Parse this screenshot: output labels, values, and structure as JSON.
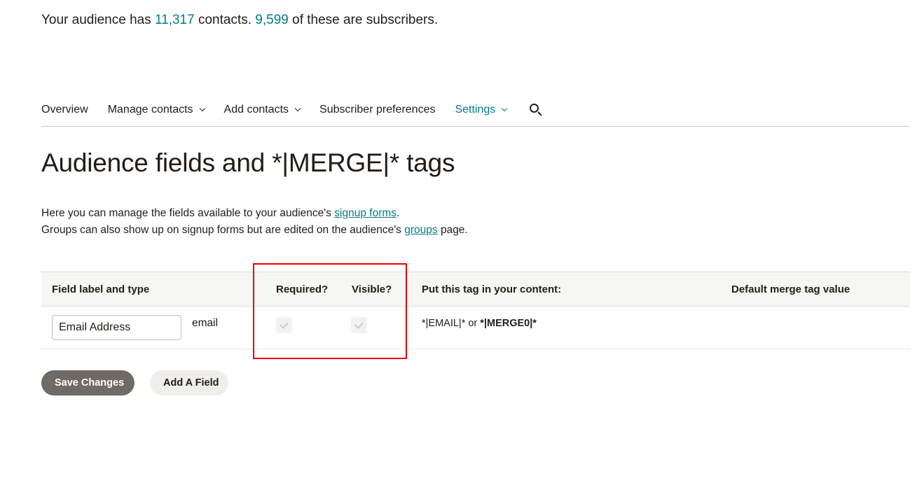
{
  "summary": {
    "prefix": "Your audience has ",
    "contacts_count": "11,317",
    "middle": " contacts. ",
    "subscribers_count": "9,599",
    "suffix": " of these are subscribers."
  },
  "nav": {
    "items": [
      {
        "label": "Overview",
        "has_dropdown": false,
        "active": false
      },
      {
        "label": "Manage contacts",
        "has_dropdown": true,
        "active": false
      },
      {
        "label": "Add contacts",
        "has_dropdown": true,
        "active": false
      },
      {
        "label": "Subscriber preferences",
        "has_dropdown": false,
        "active": false
      },
      {
        "label": "Settings",
        "has_dropdown": true,
        "active": true
      }
    ],
    "search_icon": "search-icon"
  },
  "page": {
    "title": "Audience fields and *|MERGE|* tags",
    "intro_line1_prefix": "Here you can manage the fields available to your audience's ",
    "intro_link1": "signup forms",
    "intro_line1_suffix": ".",
    "intro_line2_prefix": "Groups can also show up on signup forms but are edited on the audience's ",
    "intro_link2": "groups",
    "intro_line2_suffix": " page."
  },
  "table": {
    "headers": {
      "field": "Field label and type",
      "required": "Required?",
      "visible": "Visible?",
      "tag": "Put this tag in your content:",
      "default": "Default merge tag value"
    },
    "rows": [
      {
        "label_value": "Email Address",
        "type": "email",
        "required": true,
        "visible": true,
        "disabled": true,
        "tag_plain": "*|EMAIL|*",
        "tag_or": " or ",
        "tag_bold": "*|MERGE0|*",
        "default_value": ""
      }
    ]
  },
  "buttons": {
    "save": "Save Changes",
    "add_field": "Add A Field"
  },
  "colors": {
    "accent": "#007c89",
    "text": "#241c15",
    "highlight": "#e60000",
    "save_button": "#6f6a66",
    "secondary_button": "#efeeea"
  }
}
